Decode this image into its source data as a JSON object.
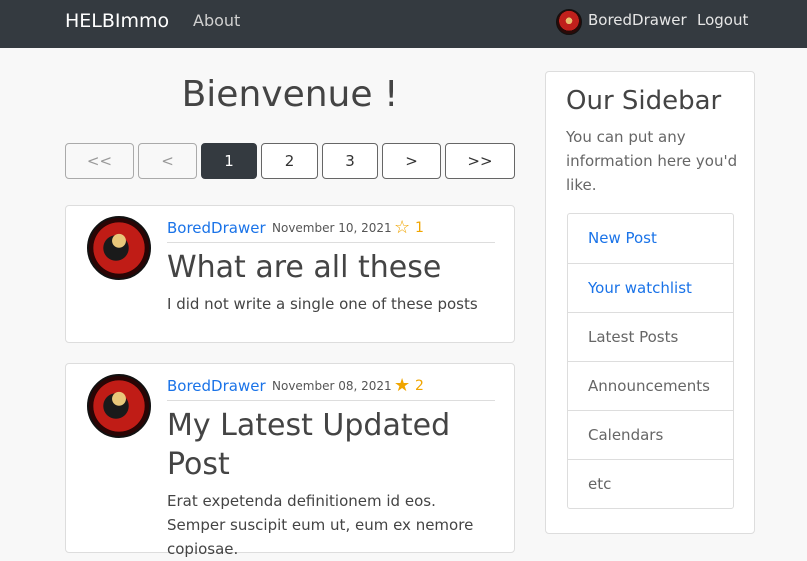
{
  "nav": {
    "brand": "HELBImmo",
    "about": "About",
    "username": "BoredDrawer",
    "logout": "Logout"
  },
  "page_title": "Bienvenue !",
  "pagination": {
    "first": "<<",
    "prev": "<",
    "pages": [
      "1",
      "2",
      "3"
    ],
    "current": "1",
    "next": ">",
    "last": ">>"
  },
  "posts": [
    {
      "author": "BoredDrawer",
      "date": "November 10, 2021",
      "star_icon": "star-outline-icon",
      "rating": "1",
      "title": "What are all these",
      "body": "I did not write a single one of these posts"
    },
    {
      "author": "BoredDrawer",
      "date": "November 08, 2021",
      "star_icon": "star-filled-icon",
      "rating": "2",
      "title": "My Latest Updated Post",
      "body": "Erat expetenda definitionem id eos. Semper suscipit eum ut, eum ex nemore copiosae."
    }
  ],
  "sidebar": {
    "title": "Our Sidebar",
    "text": "You can put any information here you'd like.",
    "items": [
      {
        "label": "New Post"
      },
      {
        "label": "Your watchlist"
      },
      {
        "label": "Latest Posts"
      },
      {
        "label": "Announcements"
      },
      {
        "label": "Calendars"
      },
      {
        "label": "etc"
      }
    ]
  },
  "colors": {
    "navbar": "#343a40",
    "link": "#1a73e8",
    "star": "#f0a500"
  }
}
